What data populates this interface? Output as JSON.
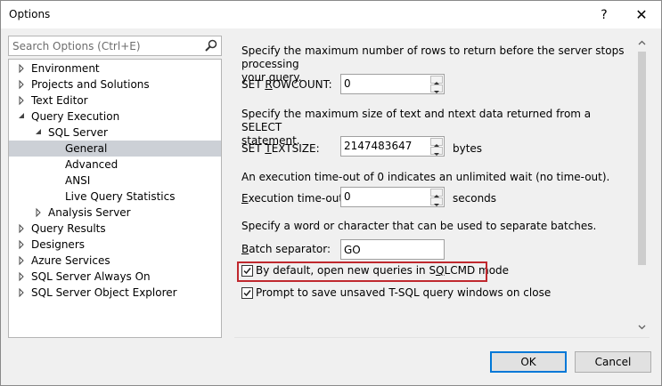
{
  "window": {
    "title": "Options",
    "help_glyph": "?",
    "close_glyph": "✕"
  },
  "search": {
    "placeholder": "Search Options (Ctrl+E)"
  },
  "tree": {
    "items": [
      {
        "label": "Environment",
        "arrow": "collapsed"
      },
      {
        "label": "Projects and Solutions",
        "arrow": "collapsed"
      },
      {
        "label": "Text Editor",
        "arrow": "collapsed"
      },
      {
        "label": "Query Execution",
        "arrow": "expanded"
      },
      {
        "label": "SQL Server",
        "arrow": "expanded"
      },
      {
        "label": "General",
        "arrow": "none",
        "selected": true
      },
      {
        "label": "Advanced",
        "arrow": "none"
      },
      {
        "label": "ANSI",
        "arrow": "none"
      },
      {
        "label": "Live Query Statistics",
        "arrow": "none"
      },
      {
        "label": "Analysis Server",
        "arrow": "collapsed"
      },
      {
        "label": "Query Results",
        "arrow": "collapsed"
      },
      {
        "label": "Designers",
        "arrow": "collapsed"
      },
      {
        "label": "Azure Services",
        "arrow": "collapsed"
      },
      {
        "label": "SQL Server Always On",
        "arrow": "collapsed"
      },
      {
        "label": "SQL Server Object Explorer",
        "arrow": "collapsed"
      }
    ]
  },
  "content": {
    "rowcount_desc_1": "Specify the maximum number of rows to return before the server stops processing",
    "rowcount_desc_2": "your query.",
    "rowcount_label_pre": "SET ",
    "rowcount_label_u": "R",
    "rowcount_label_post": "OWCOUNT:",
    "rowcount_value": "0",
    "textsize_desc_1": "Specify the maximum size of text and ntext data returned from a SELECT",
    "textsize_desc_2": "statement.",
    "textsize_label_pre": "SET ",
    "textsize_label_u": "T",
    "textsize_label_post": "EXTSIZE:",
    "textsize_value": "2147483647",
    "textsize_unit": "bytes",
    "timeout_desc": "An execution time-out of 0 indicates an unlimited wait (no time-out).",
    "timeout_label_u": "E",
    "timeout_label_post": "xecution time-out:",
    "timeout_value": "0",
    "timeout_unit": "seconds",
    "batch_desc": "Specify a word or character that can be used to separate batches.",
    "batch_label_u": "B",
    "batch_label_post": "atch separator:",
    "batch_value": "GO",
    "sqlcmd_label_pre": "By default, open new queries in S",
    "sqlcmd_label_u": "Q",
    "sqlcmd_label_post": "LCMD mode",
    "sqlcmd_checked": true,
    "prompt_label": "Prompt to save unsaved T-SQL query windows on close",
    "prompt_checked": true
  },
  "buttons": {
    "ok": "OK",
    "cancel": "Cancel"
  },
  "colors": {
    "selection": "#ccd0d6",
    "highlight_border": "#c0282e",
    "ok_border": "#0078d7"
  }
}
